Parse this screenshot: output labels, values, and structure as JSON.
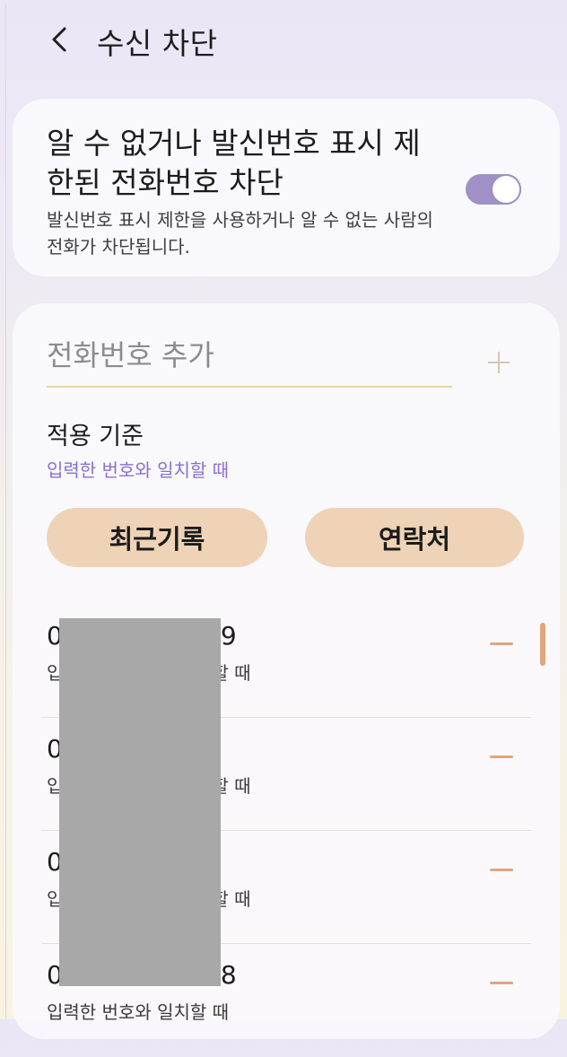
{
  "header": {
    "title": "수신 차단",
    "back_icon": "chevron-left-icon"
  },
  "unknown_block": {
    "title": "알 수 없거나 발신번호 표시 제한된 전화번호 차단",
    "description": "발신번호 표시 제한을 사용하거나 알 수 없는 사람의 전화가 차단됩니다.",
    "toggle_on": true,
    "accent_color": "#9f90c6"
  },
  "add_number": {
    "placeholder": "전화번호 추가",
    "add_icon": "plus-icon"
  },
  "criteria": {
    "label": "적용 기준",
    "value": "입력한 번호와 일치할 때"
  },
  "buttons": {
    "recent_label": "최근기록",
    "contacts_label": "연락처"
  },
  "blocked_list": [
    {
      "number": "0",
      "number_end": "9",
      "sub": "입",
      "sub_end": "할 때"
    },
    {
      "number": "0",
      "number_end": "",
      "sub": "입",
      "sub_end": "할 때"
    },
    {
      "number": "0",
      "number_end": "",
      "sub": "입",
      "sub_end": "할 때"
    },
    {
      "number": "0",
      "number_end": "8",
      "sub": "입력한 번호와 일치할 때",
      "sub_end": ""
    }
  ],
  "colors": {
    "pill_bg": "#eed3b6",
    "minus": "#e0a57b",
    "criteria_text": "#8b6fd1"
  }
}
